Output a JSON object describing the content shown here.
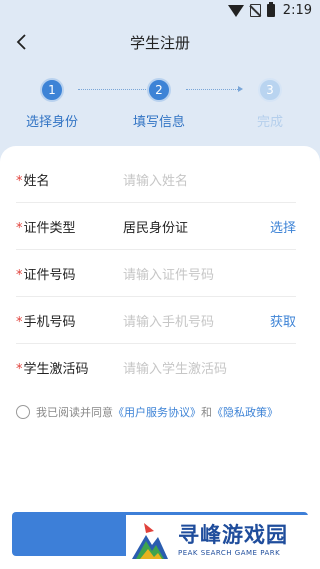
{
  "status_bar": {
    "time": "2:19"
  },
  "nav": {
    "title": "学生注册"
  },
  "steps": [
    {
      "number": "1",
      "label": "选择身份"
    },
    {
      "number": "2",
      "label": "填写信息"
    },
    {
      "number": "3",
      "label": "完成"
    }
  ],
  "form": {
    "required_mark": "*",
    "name": {
      "label": "姓名",
      "placeholder": "请输入姓名"
    },
    "id_type": {
      "label": "证件类型",
      "value": "居民身份证",
      "action": "选择"
    },
    "id_number": {
      "label": "证件号码",
      "placeholder": "请输入证件号码"
    },
    "phone": {
      "label": "手机号码",
      "placeholder": "请输入手机号码",
      "action": "获取"
    },
    "activation": {
      "label": "学生激活码",
      "placeholder": "请输入学生激活码"
    }
  },
  "agreement": {
    "prefix": "我已阅读并同意",
    "user_agreement": "《用户服务协议》",
    "conjunction": "和",
    "privacy_policy": "《隐私政策》"
  },
  "watermark": {
    "name": "寻峰游戏园",
    "subtitle": "PEAK SEARCH GAME PARK"
  }
}
